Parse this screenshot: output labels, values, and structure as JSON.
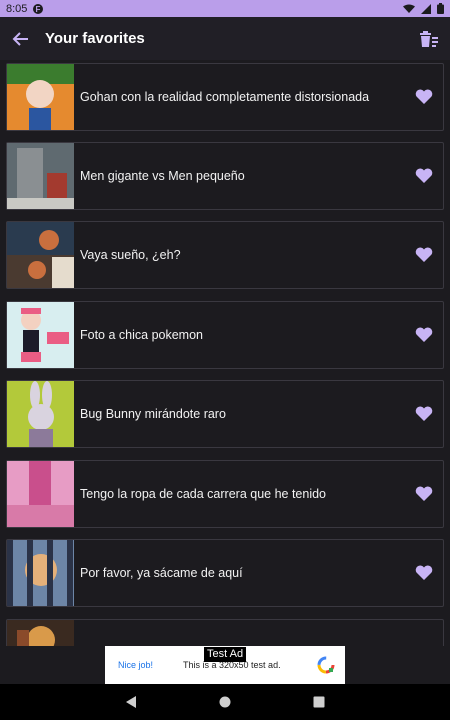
{
  "status": {
    "time": "8:05",
    "bar_color": "#ba9eea"
  },
  "header": {
    "title": "Your favorites",
    "back_icon": "arrow-left-icon",
    "delete_icon": "delete-list-icon"
  },
  "favorites": [
    {
      "label": "Gohan con la realidad completamente distorsionada",
      "thumb_colors": [
        "#e58a2f",
        "#3b7c2e",
        "#f2d5c4"
      ]
    },
    {
      "label": "Men gigante vs Men pequeño",
      "thumb_colors": [
        "#5f6a70",
        "#a33a2f",
        "#c9c9c4"
      ]
    },
    {
      "label": "Vaya sueño, ¿eh?",
      "thumb_colors": [
        "#2a3b4f",
        "#c96f3e",
        "#e5dccd"
      ]
    },
    {
      "label": "Foto a chica pokemon",
      "thumb_colors": [
        "#d8eef0",
        "#ea5d84",
        "#1c1c2a"
      ]
    },
    {
      "label": "Bug Bunny mirándote raro",
      "thumb_colors": [
        "#b3c93a",
        "#d9d3df",
        "#8c7a9a"
      ]
    },
    {
      "label": "Tengo la ropa de cada carrera que he tenido",
      "thumb_colors": [
        "#e79cc5",
        "#c94f8c",
        "#f6d3e2"
      ]
    },
    {
      "label": "Por favor, ya sácame de aquí",
      "thumb_colors": [
        "#6d86a7",
        "#e5b17a",
        "#2b3347"
      ]
    },
    {
      "label": "",
      "thumb_colors": [
        "#8a4a2a",
        "#d99a4a",
        "#3a2a20"
      ]
    }
  ],
  "accent_color": "#c8b4f5",
  "ad": {
    "tag": "Test Ad",
    "nice_job": "Nice job!",
    "text": "This is a 320x50 test ad."
  }
}
